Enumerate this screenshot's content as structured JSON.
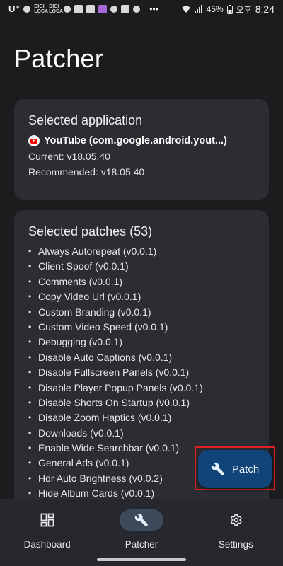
{
  "status_bar": {
    "carrier": "U⁺",
    "tiny_label_1": "DIGI LOCA",
    "tiny_label_2": "DIGI LOCA",
    "battery": "45%",
    "ampm": "오후",
    "time": "8:24",
    "dots": "•••"
  },
  "page_title": "Patcher",
  "selected_application": {
    "title": "Selected application",
    "app_name": "YouTube (com.google.android.yout...)",
    "current": "Current: v18.05.40",
    "recommended": "Recommended: v18.05.40"
  },
  "selected_patches": {
    "title": "Selected patches (53)",
    "items": [
      "Always Autorepeat (v0.0.1)",
      "Client Spoof (v0.0.1)",
      "Comments (v0.0.1)",
      "Copy Video Url (v0.0.1)",
      "Custom Branding (v0.0.1)",
      "Custom Video Speed (v0.0.1)",
      "Debugging (v0.0.1)",
      "Disable Auto Captions (v0.0.1)",
      "Disable Fullscreen Panels (v0.0.1)",
      "Disable Player Popup Panels (v0.0.1)",
      "Disable Shorts On Startup (v0.0.1)",
      "Disable Zoom Haptics (v0.0.1)",
      "Downloads (v0.0.1)",
      "Enable Wide Searchbar (v0.0.1)",
      "General Ads (v0.0.1)",
      "Hdr Auto Brightness (v0.0.2)",
      "Hide Album Cards (v0.0.1)"
    ]
  },
  "fab": {
    "label": "Patch",
    "icon": "wrench-icon"
  },
  "bottom_nav": {
    "items": [
      {
        "label": "Dashboard",
        "icon": "dashboard-icon"
      },
      {
        "label": "Patcher",
        "icon": "wrench-icon"
      },
      {
        "label": "Settings",
        "icon": "gear-icon"
      }
    ]
  },
  "colors": {
    "background": "#1c1c1f",
    "card": "#2b2d33",
    "fab": "#11457a",
    "nav_active": "#3d4a5c",
    "highlight": "#e02020"
  }
}
